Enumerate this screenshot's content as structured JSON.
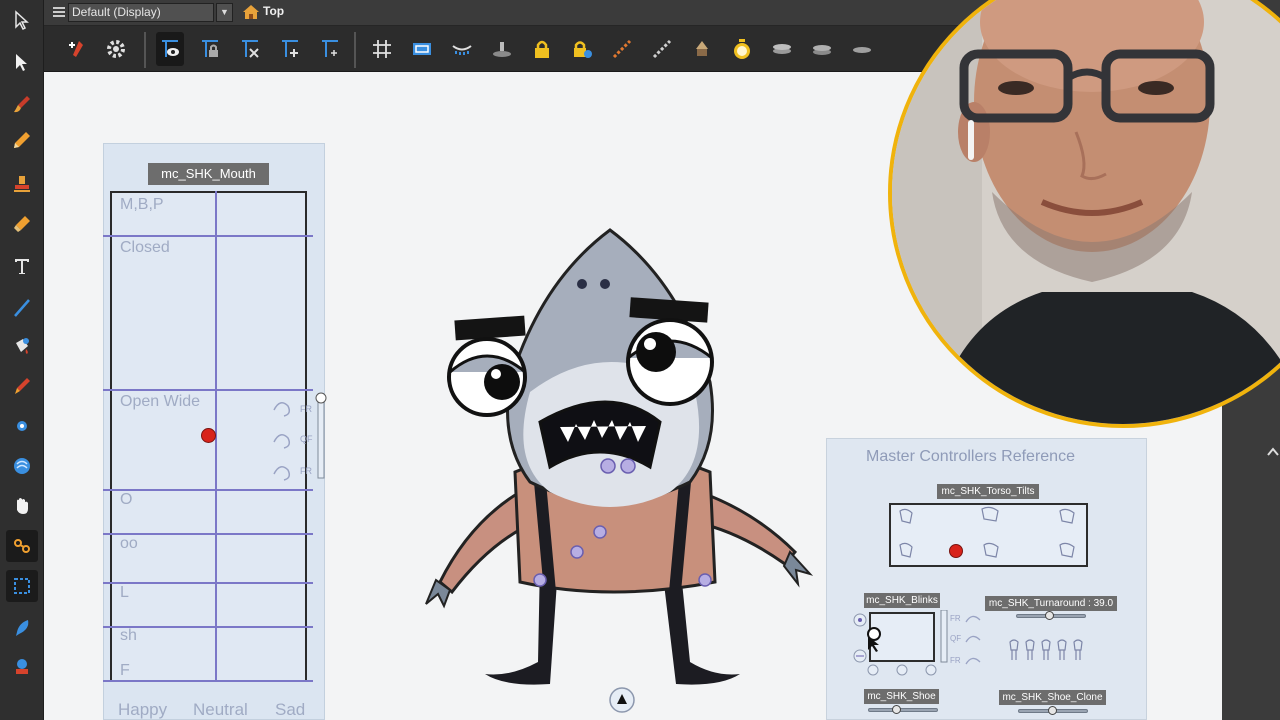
{
  "header": {
    "view_name": "Default (Display)",
    "breadcrumb": "Top"
  },
  "mouth_controller": {
    "title": "mc_SHK_Mouth",
    "rows": [
      "M,B,P",
      "Closed",
      "Open Wide",
      "O",
      "oo",
      "L",
      "sh",
      "F"
    ],
    "columns": [
      "Happy",
      "Neutral",
      "Sad"
    ],
    "slider_labels": [
      "FR",
      "QF",
      "FR"
    ]
  },
  "master_reference": {
    "title": "Master Controllers Reference",
    "torso_tilts": "mc_SHK_Torso_Tilts",
    "blinks": "mc_SHK_Blinks",
    "turnaround": "mc_SHK_Turnaround : 39.0",
    "shoe": "mc_SHK_Shoe",
    "shoe_clone": "mc_SHK_Shoe_Clone",
    "blink_side_labels": [
      "FR",
      "QF",
      "FR"
    ]
  },
  "colors": {
    "accent_ring": "#f0b30c",
    "control_point": "#d8231b",
    "grid_line": "#7b77c7"
  }
}
